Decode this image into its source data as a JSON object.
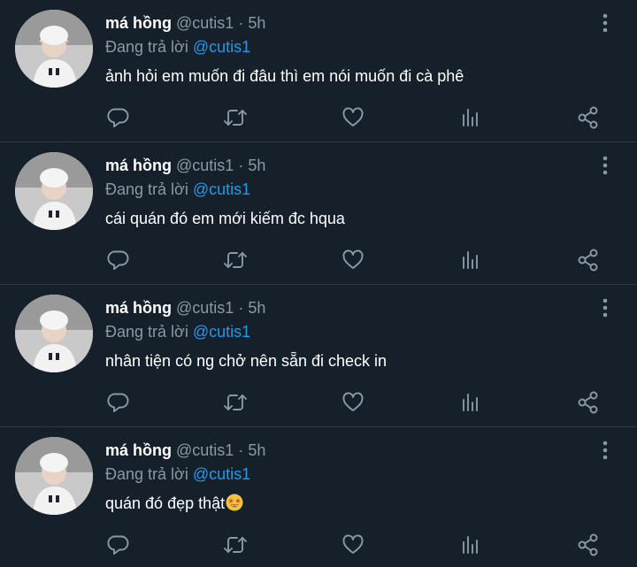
{
  "colors": {
    "background": "#15202b",
    "text": "#ffffff",
    "muted": "#8b98a5",
    "link": "#1d9bf0",
    "divider": "#2f3b47"
  },
  "icons": {
    "reply": "reply-icon",
    "retweet": "retweet-icon",
    "like": "heart-icon",
    "views": "views-icon",
    "share": "share-icon",
    "more": "more-vertical-icon"
  },
  "tweets": [
    {
      "name": "má hồng",
      "handle": "@cutis1",
      "dot": "·",
      "time": "5h",
      "reply_prefix": "Đang trả lời",
      "reply_to": "@cutis1",
      "text": "ảnh hỏi em muốn đi đâu thì em nói muốn đi cà phê"
    },
    {
      "name": "má hồng",
      "handle": "@cutis1",
      "dot": "·",
      "time": "5h",
      "reply_prefix": "Đang trả lời",
      "reply_to": "@cutis1",
      "text": "cái quán đó em mới kiếm đc hqua"
    },
    {
      "name": "má hồng",
      "handle": "@cutis1",
      "dot": "·",
      "time": "5h",
      "reply_prefix": "Đang trả lời",
      "reply_to": "@cutis1",
      "text": "nhân tiện có ng chở nên sẵn đi check in"
    },
    {
      "name": "má hồng",
      "handle": "@cutis1",
      "dot": "·",
      "time": "5h",
      "reply_prefix": "Đang trả lời",
      "reply_to": "@cutis1",
      "text": "quán đó đẹp thật",
      "emoji": "star-struck-emoji"
    }
  ]
}
